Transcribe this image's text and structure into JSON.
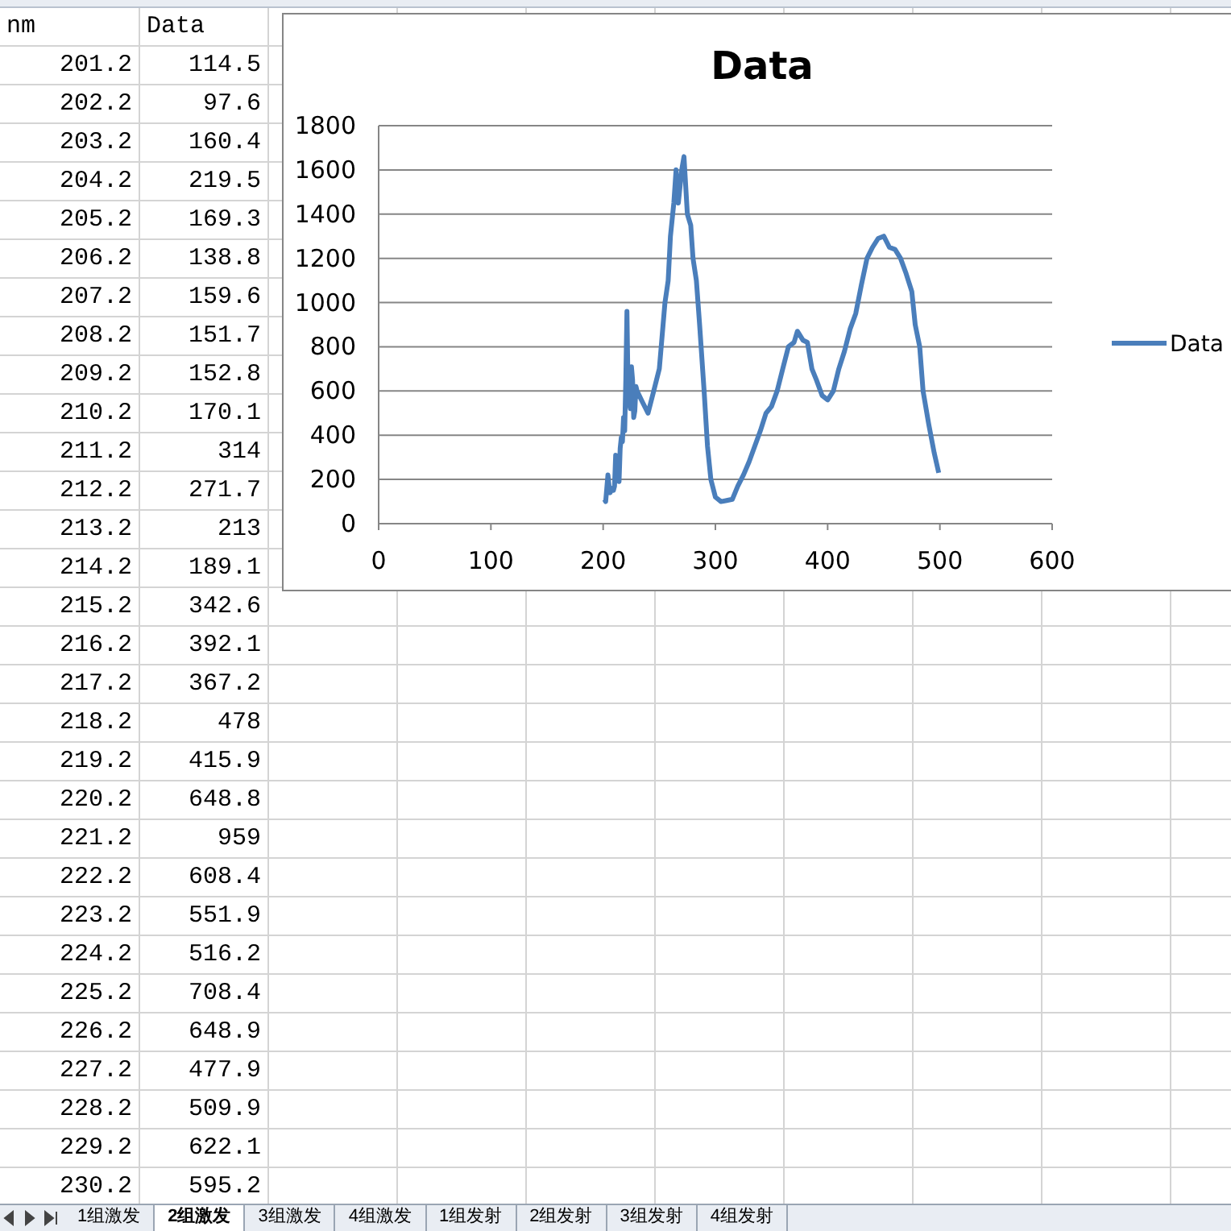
{
  "table": {
    "columns": [
      "nm",
      "Data"
    ],
    "rows": [
      [
        "201.2",
        "114.5"
      ],
      [
        "202.2",
        "97.6"
      ],
      [
        "203.2",
        "160.4"
      ],
      [
        "204.2",
        "219.5"
      ],
      [
        "205.2",
        "169.3"
      ],
      [
        "206.2",
        "138.8"
      ],
      [
        "207.2",
        "159.6"
      ],
      [
        "208.2",
        "151.7"
      ],
      [
        "209.2",
        "152.8"
      ],
      [
        "210.2",
        "170.1"
      ],
      [
        "211.2",
        "314"
      ],
      [
        "212.2",
        "271.7"
      ],
      [
        "213.2",
        "213"
      ],
      [
        "214.2",
        "189.1"
      ],
      [
        "215.2",
        "342.6"
      ],
      [
        "216.2",
        "392.1"
      ],
      [
        "217.2",
        "367.2"
      ],
      [
        "218.2",
        "478"
      ],
      [
        "219.2",
        "415.9"
      ],
      [
        "220.2",
        "648.8"
      ],
      [
        "221.2",
        "959"
      ],
      [
        "222.2",
        "608.4"
      ],
      [
        "223.2",
        "551.9"
      ],
      [
        "224.2",
        "516.2"
      ],
      [
        "225.2",
        "708.4"
      ],
      [
        "226.2",
        "648.9"
      ],
      [
        "227.2",
        "477.9"
      ],
      [
        "228.2",
        "509.9"
      ],
      [
        "229.2",
        "622.1"
      ],
      [
        "230.2",
        "595.2"
      ]
    ]
  },
  "chart": {
    "chart_data": {
      "type": "line",
      "title": "Data",
      "x": [
        201.2,
        202.2,
        203.2,
        204.2,
        205.2,
        206.2,
        207.2,
        208.2,
        209.2,
        210.2,
        211.2,
        212.2,
        213.2,
        214.2,
        215.2,
        216.2,
        217.2,
        218.2,
        219.2,
        220.2,
        221.2,
        222.2,
        223.2,
        224.2,
        225.2,
        226.2,
        227.2,
        228.2,
        229.2,
        230.2,
        235,
        240,
        245,
        250,
        255,
        258,
        260,
        263,
        265,
        267,
        270,
        272,
        275,
        278,
        280,
        283,
        286,
        290,
        293,
        296,
        300,
        305,
        310,
        315,
        320,
        325,
        330,
        335,
        340,
        345,
        350,
        355,
        360,
        365,
        370,
        373,
        378,
        382,
        386,
        390,
        395,
        400,
        405,
        410,
        415,
        420,
        425,
        430,
        435,
        440,
        445,
        450,
        455,
        460,
        465,
        470,
        475,
        478,
        482,
        485,
        490,
        495,
        499
      ],
      "grid": true,
      "series": [
        {
          "name": "Data",
          "color": "#4a7ebb",
          "values": [
            110,
            100,
            160,
            220,
            170,
            140,
            160,
            150,
            150,
            170,
            310,
            270,
            210,
            190,
            340,
            390,
            370,
            480,
            420,
            650,
            960,
            610,
            550,
            520,
            710,
            650,
            480,
            510,
            620,
            600,
            550,
            500,
            600,
            700,
            1000,
            1100,
            1300,
            1450,
            1600,
            1450,
            1600,
            1660,
            1400,
            1350,
            1200,
            1100,
            900,
            600,
            350,
            200,
            120,
            100,
            105,
            110,
            170,
            220,
            280,
            350,
            420,
            500,
            530,
            600,
            700,
            800,
            820,
            870,
            830,
            820,
            700,
            650,
            580,
            560,
            600,
            700,
            780,
            880,
            950,
            1080,
            1200,
            1250,
            1290,
            1300,
            1250,
            1240,
            1200,
            1130,
            1050,
            900,
            800,
            600,
            450,
            320,
            230
          ]
        }
      ],
      "xlim": [
        0,
        600
      ],
      "ylim": [
        0,
        1800
      ],
      "xticks": [
        0,
        100,
        200,
        300,
        400,
        500,
        600
      ],
      "yticks": [
        0,
        200,
        400,
        600,
        800,
        1000,
        1200,
        1400,
        1600,
        1800
      ]
    }
  },
  "sheet_tabs": [
    {
      "label": "1组激发",
      "selected": false
    },
    {
      "label": "2组激发",
      "selected": true
    },
    {
      "label": "3组激发",
      "selected": false
    },
    {
      "label": "4组激发",
      "selected": false
    },
    {
      "label": "1组发射",
      "selected": false
    },
    {
      "label": "2组发射",
      "selected": false
    },
    {
      "label": "3组发射",
      "selected": false
    },
    {
      "label": "4组发射",
      "selected": false
    }
  ]
}
